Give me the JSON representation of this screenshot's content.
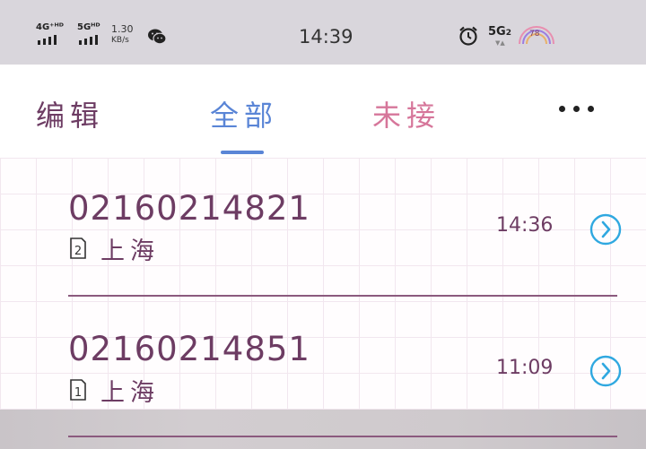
{
  "status_bar": {
    "net1_label": "4G⁺ᴴᴰ",
    "net2_label": "5Gᴴᴰ",
    "speed_value": "1.30",
    "speed_unit": "KB/s",
    "time": "14:39",
    "fiveg_label": "5G",
    "fiveg_sub": "2",
    "battery_level": "78",
    "icons": [
      "wechat-icon",
      "alarm-icon",
      "battery-icon"
    ]
  },
  "tabs": {
    "edit": "编辑",
    "all": "全部",
    "missed": "未接",
    "more_icon": "more-icon",
    "active": "all"
  },
  "calls": [
    {
      "number": "02160214821",
      "sim": "2",
      "location": "上海",
      "time": "14:36"
    },
    {
      "number": "02160214851",
      "sim": "1",
      "location": "上海",
      "time": "11:09"
    }
  ],
  "colors": {
    "accent_blue": "#5a85d6",
    "text_purple": "#6d3c63",
    "missed_pink": "#d6769a",
    "detail_cyan": "#2fa8e0"
  }
}
